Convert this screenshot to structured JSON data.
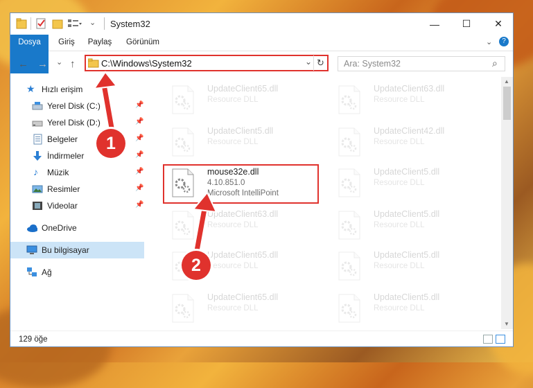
{
  "window": {
    "title": "System32",
    "minimize": "—",
    "maximize": "☐",
    "close": "✕"
  },
  "ribbon": {
    "tabs": [
      "Dosya",
      "Giriş",
      "Paylaş",
      "Görünüm"
    ]
  },
  "nav": {
    "back": "←",
    "forward": "→",
    "recent": "⌄",
    "up": "↑",
    "address": "C:\\Windows\\System32",
    "address_dropdown": "⌄",
    "refresh": "↻",
    "search_placeholder": "Ara: System32",
    "search_icon": "⌕"
  },
  "sidebar": {
    "items": [
      {
        "label": "Hızlı erişim",
        "icon": "star-icon"
      },
      {
        "label": "Yerel Disk (C:)",
        "icon": "drive-icon"
      },
      {
        "label": "Yerel Disk (D:)",
        "icon": "drive-icon"
      },
      {
        "label": "Belgeler",
        "icon": "documents-icon"
      },
      {
        "label": "İndirmeler",
        "icon": "download-icon"
      },
      {
        "label": "Müzik",
        "icon": "music-icon"
      },
      {
        "label": "Resimler",
        "icon": "pictures-icon"
      },
      {
        "label": "Videolar",
        "icon": "videos-icon"
      },
      {
        "label": "OneDrive",
        "icon": "cloud-icon"
      },
      {
        "label": "Bu bilgisayar",
        "icon": "computer-icon"
      },
      {
        "label": "Ağ",
        "icon": "network-icon"
      }
    ],
    "pin": "📌"
  },
  "files": [
    {
      "name": "UpdateClient65.dll",
      "type": "Resource DLL"
    },
    {
      "name": "UpdateClient63.dll",
      "type": "Resource DLL"
    },
    {
      "name": "UpdateClient5.dll",
      "type": "Resource DLL"
    },
    {
      "name": "UpdateClient42.dll",
      "type": "Resource DLL"
    },
    {
      "name": "mouse32e.dll",
      "version": "4.10.851.0",
      "company": "Microsoft IntelliPoint"
    },
    {
      "name": "UpdateClient5.dll",
      "type": "Resource DLL"
    },
    {
      "name": "UpdateClient63.dll",
      "type": "Resource DLL"
    },
    {
      "name": "UpdateClient5.dll",
      "type": "Resource DLL"
    },
    {
      "name": "UpdateClient65.dll",
      "type": "Resource DLL"
    },
    {
      "name": "UpdateClient5.dll",
      "type": "Resource DLL"
    },
    {
      "name": "UpdateClient65.dll",
      "type": "Resource DLL"
    },
    {
      "name": "UpdateClient5.dll",
      "type": "Resource DLL"
    }
  ],
  "status": {
    "count": "129 öğe"
  },
  "annotations": {
    "step1": "1",
    "step2": "2"
  },
  "colors": {
    "accent": "#1979ca",
    "highlight": "#e0322d",
    "selected": "#cce4f7"
  }
}
